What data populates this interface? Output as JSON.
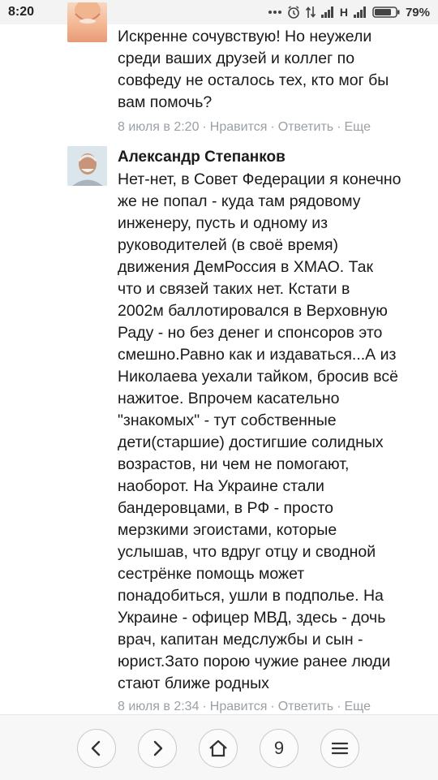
{
  "status_bar": {
    "time": "8:20",
    "network": "H",
    "battery": "79%",
    "icons": [
      "dots-icon",
      "alarm-icon",
      "data-transfer-icon",
      "signal-icon",
      "signal-icon",
      "battery-icon"
    ]
  },
  "comments": [
    {
      "text": "Искренне сочувствую! Но неужели\nсреди ваших друзей и коллег по\nсовфеду не осталось тех, кто мог бы\nвам помочь?",
      "date": "8 июля в 2:20",
      "like": "Нравится",
      "reply": "Ответить",
      "more": "Еще"
    },
    {
      "author": "Александр Степанков",
      "text": "Нет-нет, в Совет Федерации я конечно\nже не попал - куда там рядовому\nинженеру, пусть и одному из\nруководителей (в своё время)\nдвижения ДемРоссия в ХМАО. Так\nчто и связей таких нет. Кстати в\n2002м баллотировался в Верховную\nРаду - но без денег и спонсоров это\nсмешно.Равно как и издаваться...А из\nНиколаева уехали тайком, бросив всё\nнажитое. Впрочем касательно\n\"знакомых\" - тут собственные\nдети(старшие) достигшие солидных\nвозрастов, ни чем не помогают,\nнаоборот. На Украине стали\nбандеровцами, в РФ - просто\nмерзкими эгоистами, которые\nуслышав, что вдруг отцу и сводной\nсестрёнке помощь может\nпонадобиться, ушли в подполье. На\nУкраине - офицер МВД, здесь - дочь\nврач, капитан медслужбы и сын -\nюрист.Зато порою чужие ранее люди\nстают ближе родных",
      "date": "8 июля в 2:34",
      "like": "Нравится",
      "reply": "Ответить",
      "more": "Еще"
    }
  ],
  "meta_separator": "·",
  "navbar": {
    "tab_count": "9",
    "icons": [
      "back-icon",
      "forward-icon",
      "home-icon",
      "tabs-button",
      "menu-icon"
    ]
  },
  "colors": {
    "meta": "#9aa0a6",
    "text": "#1a1a1a",
    "status_bg": "#f3f3f3",
    "nav_bg": "#f7f7f7"
  }
}
